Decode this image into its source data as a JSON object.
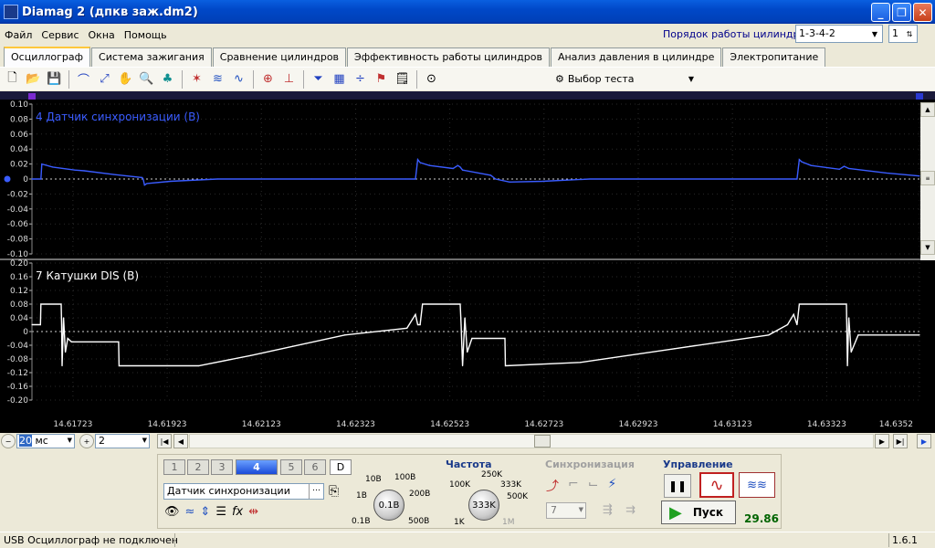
{
  "window": {
    "title": "Diamag 2 (дпкв заж.dm2)"
  },
  "menu": [
    "Файл",
    "Сервис",
    "Окна",
    "Помощь"
  ],
  "firing_order": {
    "label": "Порядок работы цилиндров",
    "value": "1-3-4-2",
    "cylinder": "1"
  },
  "tabs": [
    "Осциллограф",
    "Система зажигания",
    "Сравнение цилиндров",
    "Эффективность работы цилиндров",
    "Анализ давления в цилиндре",
    "Электропитание"
  ],
  "toolbar": {
    "test_select": "Выбор теста"
  },
  "navigation": {
    "zoom": "20",
    "zoom_unit": "мс",
    "page": "2"
  },
  "channels": {
    "buttons": [
      "1",
      "2",
      "3",
      "4",
      "5",
      "6",
      "D"
    ],
    "active": "4",
    "sensor": "Датчик синхронизации"
  },
  "amplitude": {
    "value": "0.1В",
    "labels": [
      "10В",
      "100В",
      "1В",
      "200В",
      "0.1В",
      "500В"
    ]
  },
  "frequency": {
    "title": "Частота",
    "value": "333K",
    "labels": [
      "250K",
      "100K",
      "333K",
      "500K",
      "1K",
      "1M"
    ]
  },
  "sync": {
    "title": "Синхронизация",
    "value": "7"
  },
  "control": {
    "title": "Управление",
    "start_label": "Пуск",
    "fps": "29.86"
  },
  "status": {
    "left": "USB Осциллограф не подключен",
    "right": "1.6.1"
  },
  "chart_data": [
    {
      "type": "line",
      "title": "4 Датчик синхронизации (В)",
      "color": "#3a5cff",
      "ylim": [
        -0.1,
        0.1
      ],
      "yticks": [
        "0.10",
        "0.08",
        "0.06",
        "0.04",
        "0.02",
        "0",
        "-0.02",
        "-0.04",
        "-0.06",
        "-0.08",
        "-0.10"
      ],
      "xticks": [
        "14.61723",
        "14.61923",
        "14.62123",
        "14.62323",
        "14.62523",
        "14.62723",
        "14.62923",
        "14.63123",
        "14.63323",
        "14.6352"
      ],
      "x": [
        14.61636,
        14.61655,
        14.61657,
        14.6168,
        14.61727,
        14.61747,
        14.6181,
        14.6187,
        14.61872,
        14.61875,
        14.6188,
        14.6193,
        14.6203,
        14.6213,
        14.6223,
        14.6233,
        14.6243,
        14.6245,
        14.62455,
        14.6246,
        14.6248,
        14.6253,
        14.6254,
        14.62545,
        14.6255,
        14.6261,
        14.6262,
        14.6265,
        14.6272,
        14.6282,
        14.6292,
        14.6302,
        14.6312,
        14.6322,
        14.6326,
        14.63265,
        14.6327,
        14.6329,
        14.6335,
        14.6336,
        14.6337,
        14.6345,
        14.6352
      ],
      "y": [
        0,
        0,
        0.02,
        0.016,
        0.012,
        0.011,
        0.006,
        0.002,
        0,
        -0.008,
        -0.006,
        -0.003,
        0,
        0,
        0,
        0,
        0,
        0,
        0.026,
        0.022,
        0.018,
        0.014,
        0.018,
        0.016,
        0.012,
        0.005,
        0,
        -0.004,
        -0.003,
        0,
        0,
        0,
        0,
        0,
        0,
        0.026,
        0.023,
        0.018,
        0.013,
        0.017,
        0.014,
        0.008,
        0.004
      ]
    },
    {
      "type": "line",
      "title": "7 Катушки DIS (В)",
      "color": "#ffffff",
      "ylim": [
        -0.2,
        0.2
      ],
      "yticks": [
        "0.20",
        "0.16",
        "0.12",
        "0.08",
        "0.04",
        "0",
        "-0.04",
        "-0.08",
        "-0.12",
        "-0.16",
        "-0.20"
      ],
      "xticks": [
        "14.61723",
        "14.61923",
        "14.62123",
        "14.62323",
        "14.62523",
        "14.62723",
        "14.62923",
        "14.63123",
        "14.63323",
        "14.6352"
      ],
      "x": [
        14.61636,
        14.61654,
        14.61655,
        14.61698,
        14.61699,
        14.617,
        14.61703,
        14.61707,
        14.61712,
        14.6172,
        14.6182,
        14.61821,
        14.6199,
        14.621,
        14.623,
        14.62432,
        14.6245,
        14.62455,
        14.6246,
        14.62465,
        14.62545,
        14.62547,
        14.6255,
        14.62555,
        14.6256,
        14.6257,
        14.6264,
        14.62641,
        14.628,
        14.63,
        14.632,
        14.6324,
        14.63253,
        14.6326,
        14.63265,
        14.63365,
        14.63367,
        14.6337,
        14.63375,
        14.6339,
        14.6352
      ],
      "y": [
        0.02,
        0.02,
        0.08,
        0.08,
        0.02,
        -0.1,
        0.04,
        -0.06,
        -0.02,
        -0.03,
        -0.03,
        -0.1,
        -0.1,
        -0.07,
        -0.01,
        0.01,
        0.05,
        0.02,
        0.02,
        0.08,
        0.08,
        0.02,
        -0.1,
        0.04,
        -0.06,
        -0.02,
        -0.02,
        -0.1,
        -0.09,
        -0.05,
        -0.01,
        0.02,
        0.05,
        0.02,
        0.08,
        0.08,
        -0.1,
        0.04,
        -0.06,
        -0.01,
        -0.01
      ]
    }
  ]
}
